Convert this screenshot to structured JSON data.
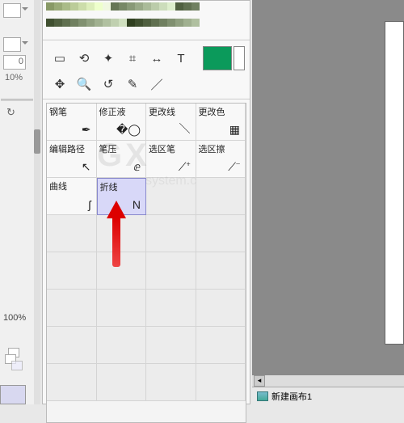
{
  "left": {
    "input_value": "0",
    "pct1": "10%",
    "pct2": "100%"
  },
  "swatches": {
    "row1": [
      "#889966",
      "#99aa77",
      "#aabb88",
      "#bbcc99",
      "#ccddaa",
      "#ddeebb",
      "#eeffcc",
      "#f0f8e0",
      "#667755",
      "#778866",
      "#889977",
      "#99aa88",
      "#aabb99",
      "#bbccaa",
      "#ccddbb",
      "#ddeecc",
      "#506040",
      "#607050",
      "#708060"
    ],
    "row2": [
      "#405030",
      "#506040",
      "#607050",
      "#708060",
      "#809070",
      "#90a080",
      "#a0b090",
      "#b0c0a0",
      "#c0d0b0",
      "#d0e0c0",
      "#304020",
      "#405030",
      "#506040",
      "#607050",
      "#708060",
      "#809070",
      "#90a080",
      "#a0b090",
      "#b0c0a0"
    ]
  },
  "toolrows": {
    "r1": [
      "select-rect",
      "lasso",
      "magic-wand",
      "crop",
      "move-tool",
      "text-tool"
    ],
    "r2": [
      "move",
      "zoom",
      "rotate",
      "eyedropper",
      "brush"
    ]
  },
  "tool_icons": {
    "select-rect": "▭",
    "lasso": "⟲",
    "magic-wand": "✦",
    "crop": "⌗",
    "move-tool": "↔",
    "text-tool": "T",
    "move": "✥",
    "zoom": "🔍",
    "rotate": "↺",
    "eyedropper": "✎",
    "brush": "／"
  },
  "color_primary": "#0b9a5b",
  "tools": [
    {
      "id": "pen",
      "label": "钢笔",
      "icon": "✒"
    },
    {
      "id": "whiteout",
      "label": "修正液",
      "icon": "�◯"
    },
    {
      "id": "change-line",
      "label": "更改线",
      "icon": "＼"
    },
    {
      "id": "change-color",
      "label": "更改色",
      "icon": "▦"
    },
    {
      "id": "edit-path",
      "label": "编辑路径",
      "icon": "↖"
    },
    {
      "id": "pressure",
      "label": "笔压",
      "icon": "ⅇ"
    },
    {
      "id": "select-pen",
      "label": "选区笔",
      "icon": "⟋⁺"
    },
    {
      "id": "select-erase",
      "label": "选区擦",
      "icon": "⟋⁻"
    },
    {
      "id": "curve",
      "label": "曲线",
      "icon": "ʃ"
    },
    {
      "id": "polyline",
      "label": "折线",
      "icon": "N",
      "selected": true
    }
  ],
  "watermark": "GX",
  "watermark2": "system.c",
  "tab": {
    "label": "新建画布1"
  }
}
